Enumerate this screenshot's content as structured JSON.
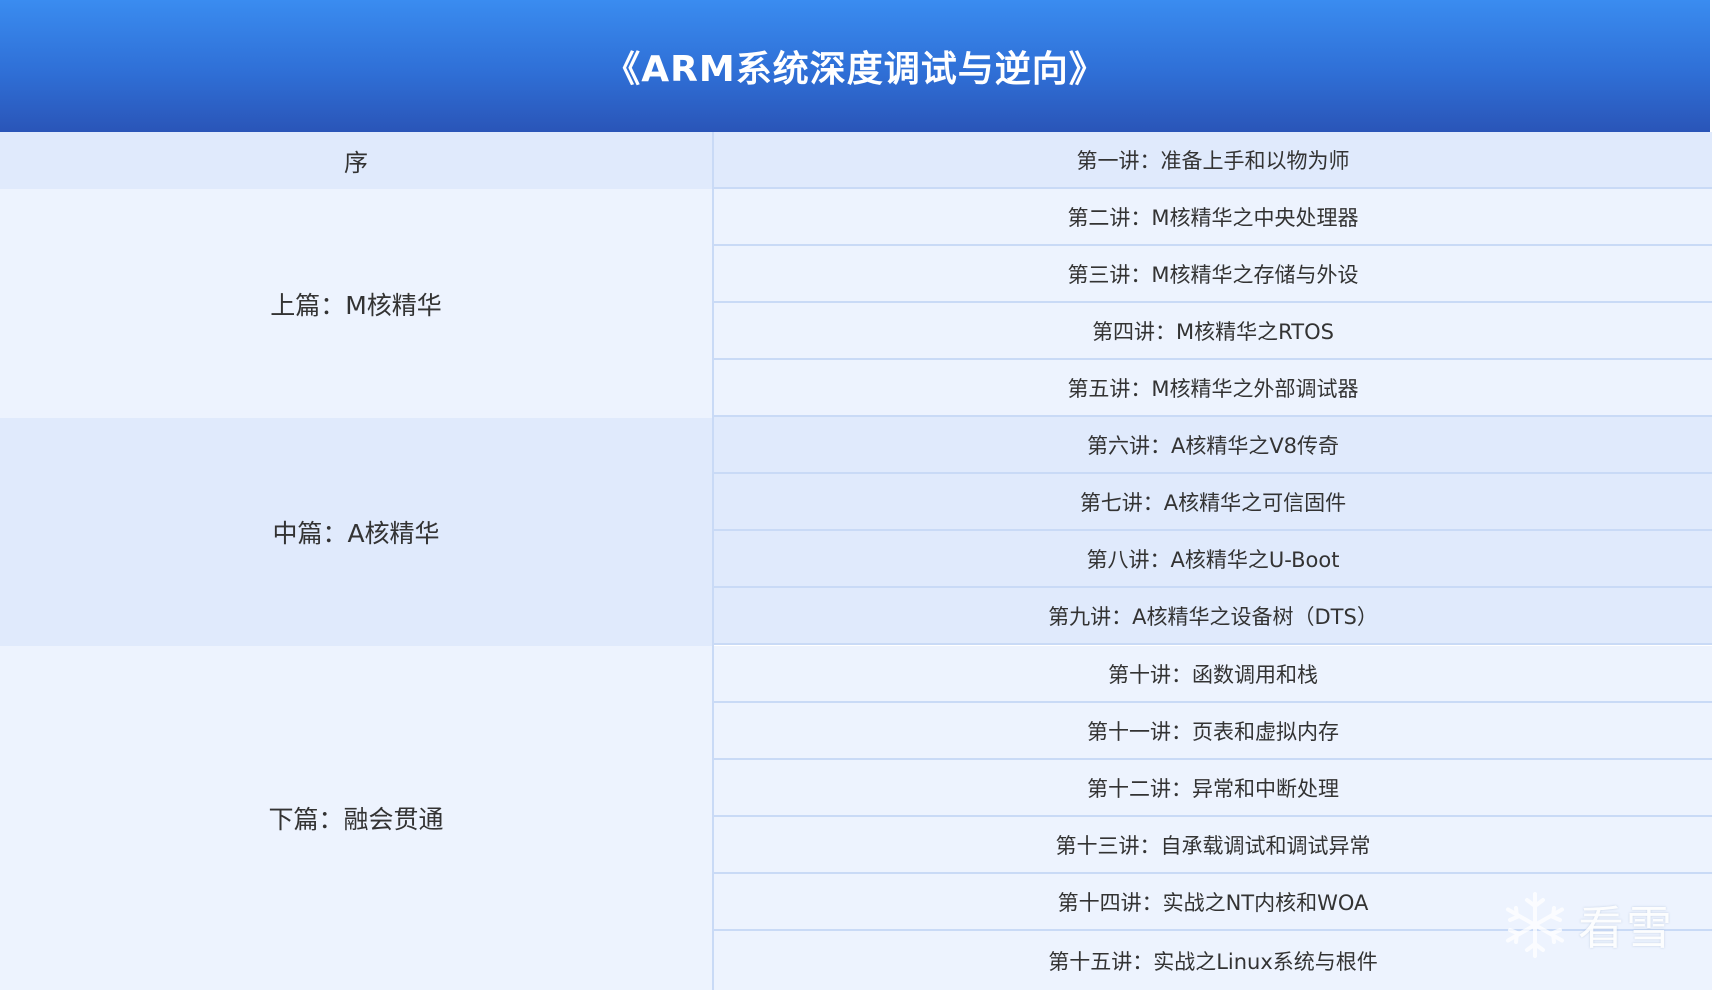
{
  "header": {
    "title": "《ARM系统深度调试与逆向》"
  },
  "sections": [
    {
      "label": "序"
    },
    {
      "label": "上篇：M核精华"
    },
    {
      "label": "中篇：A核精华"
    },
    {
      "label": "下篇：融会贯通"
    }
  ],
  "lectures": [
    {
      "label": "第一讲：准备上手和以物为师"
    },
    {
      "label": "第二讲：M核精华之中央处理器"
    },
    {
      "label": "第三讲：M核精华之存储与外设"
    },
    {
      "label": "第四讲：M核精华之RTOS"
    },
    {
      "label": "第五讲：M核精华之外部调试器"
    },
    {
      "label": "第六讲：A核精华之V8传奇"
    },
    {
      "label": "第七讲：A核精华之可信固件"
    },
    {
      "label": "第八讲：A核精华之U-Boot"
    },
    {
      "label": "第九讲：A核精华之设备树（DTS）"
    },
    {
      "label": "第十讲：函数调用和栈"
    },
    {
      "label": "第十一讲：页表和虚拟内存"
    },
    {
      "label": "第十二讲：异常和中断处理"
    },
    {
      "label": "第十三讲：自承载调试和调试异常"
    },
    {
      "label": "第十四讲：实战之NT内核和WOA"
    },
    {
      "label": "第十五讲：实战之Linux系统与根件"
    }
  ],
  "watermark": {
    "text": "看雪",
    "icon": "snowflake-icon"
  },
  "colors": {
    "header_top": "#3a8cf0",
    "header_bottom": "#2a55b8",
    "row_dark": "#e0eafc",
    "row_light": "#edf3fe",
    "border": "#c9daf6",
    "text": "#333333"
  }
}
